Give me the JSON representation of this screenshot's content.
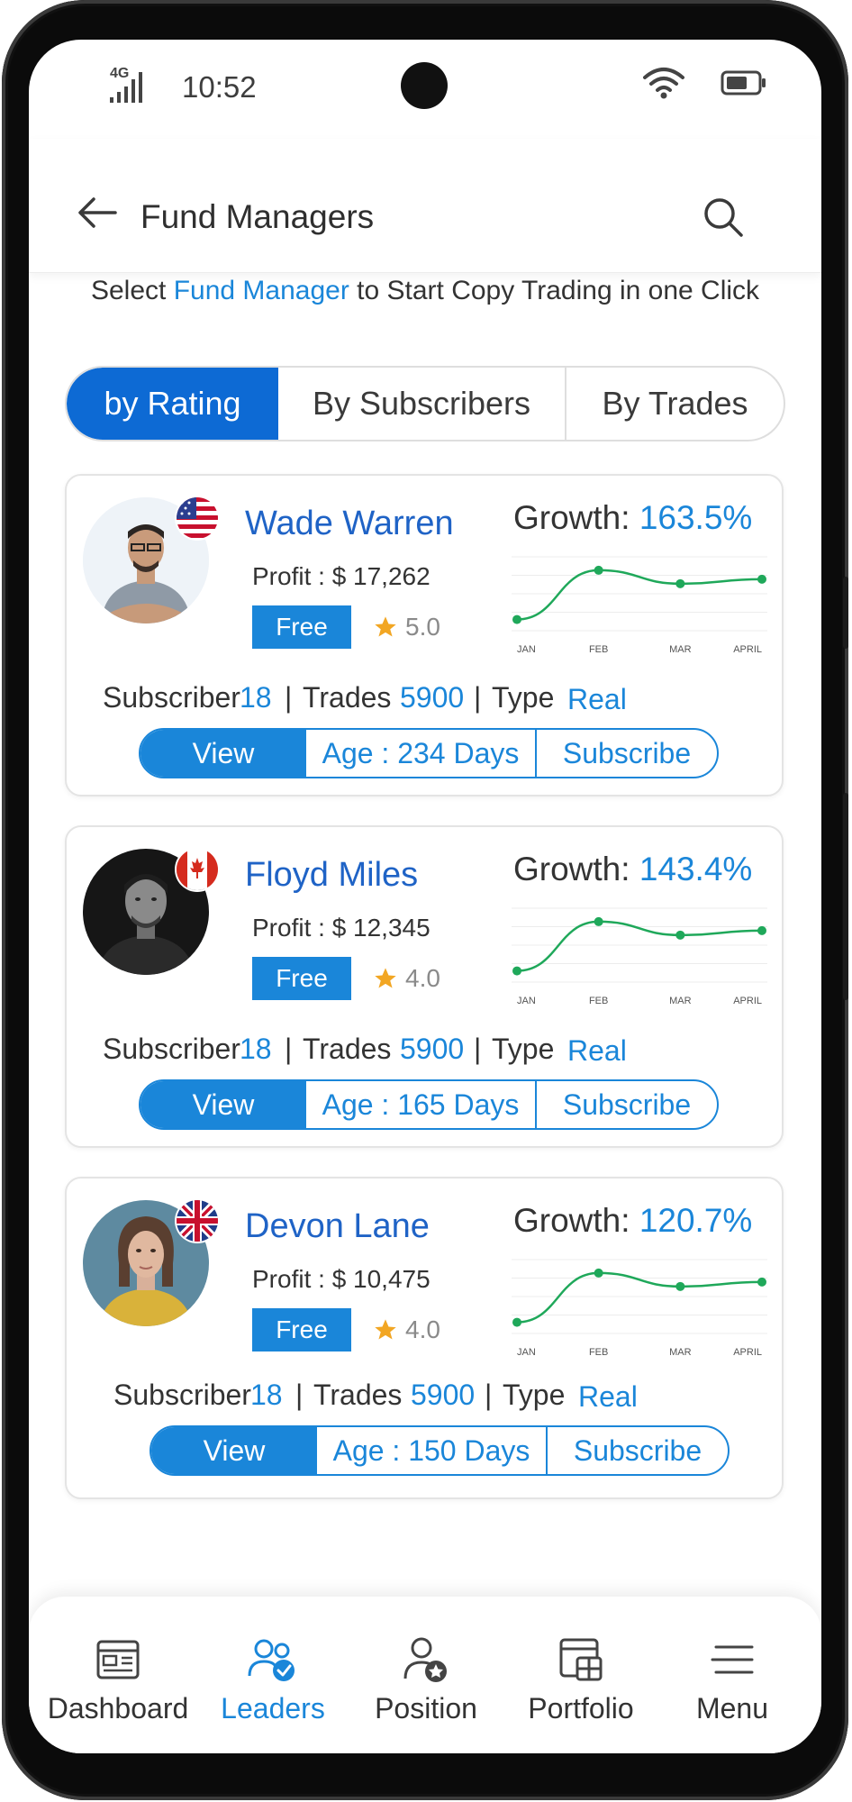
{
  "status_bar": {
    "network": "4G",
    "time": "10:52"
  },
  "header": {
    "title": "Fund Managers"
  },
  "intro": {
    "prefix": "Select",
    "highlight": "Fund Manager",
    "suffix": "to Start Copy Trading in one Click"
  },
  "sort_tabs": [
    {
      "label": "by Rating",
      "active": true
    },
    {
      "label": "By Subscribers",
      "active": false
    },
    {
      "label": "By Trades",
      "active": false
    }
  ],
  "chart_months": [
    "JAN",
    "FEB",
    "MAR",
    "APRIL"
  ],
  "managers": [
    {
      "name": "Wade Warren",
      "flag_country": "USA",
      "profit": "Profit : $ 17,262",
      "plan": "Free",
      "rating": "5.0",
      "growth_label": "Growth:",
      "growth": "163.5%",
      "subscriber_label": "Subscriber",
      "subscribers": "18",
      "trades_label": "Trades",
      "trades": "5900",
      "type_label": "Type",
      "type": "Real",
      "view_label": "View",
      "age": "Age : 234 Days",
      "subscribe_label": "Subscribe",
      "chart_data": {
        "type": "line",
        "x": [
          "JAN",
          "FEB",
          "MAR",
          "APRIL"
        ],
        "values": [
          1,
          3.2,
          2.6,
          2.8
        ]
      }
    },
    {
      "name": "Floyd Miles",
      "flag_country": "Canada",
      "profit": "Profit : $ 12,345",
      "plan": "Free",
      "rating": "4.0",
      "growth_label": "Growth:",
      "growth": "143.4%",
      "subscriber_label": "Subscriber",
      "subscribers": "18",
      "trades_label": "Trades",
      "trades": "5900",
      "type_label": "Type",
      "type": "Real",
      "view_label": "View",
      "age": "Age : 165 Days",
      "subscribe_label": "Subscribe",
      "chart_data": {
        "type": "line",
        "x": [
          "JAN",
          "FEB",
          "MAR",
          "APRIL"
        ],
        "values": [
          1,
          3.2,
          2.6,
          2.8
        ]
      }
    },
    {
      "name": "Devon Lane",
      "flag_country": "UK",
      "profit": "Profit : $ 10,475",
      "plan": "Free",
      "rating": "4.0",
      "growth_label": "Growth:",
      "growth": "120.7%",
      "subscriber_label": "Subscriber",
      "subscribers": "18",
      "trades_label": "Trades",
      "trades": "5900",
      "type_label": "Type",
      "type": "Real",
      "view_label": "View",
      "age": "Age : 150 Days",
      "subscribe_label": "Subscribe",
      "chart_data": {
        "type": "line",
        "x": [
          "JAN",
          "FEB",
          "MAR",
          "APRIL"
        ],
        "values": [
          1,
          3.2,
          2.6,
          2.8
        ]
      }
    }
  ],
  "bottom_nav": [
    {
      "label": "Dashboard",
      "icon": "dashboard-icon",
      "active": false
    },
    {
      "label": "Leaders",
      "icon": "leaders-icon",
      "active": true
    },
    {
      "label": "Position",
      "icon": "position-icon",
      "active": false
    },
    {
      "label": "Portfolio",
      "icon": "portfolio-icon",
      "active": false
    },
    {
      "label": "Menu",
      "icon": "menu-icon",
      "active": false
    }
  ],
  "colors": {
    "primary": "#1a86d9",
    "tab_active": "#0d6ad4",
    "chart_line": "#1fa85a",
    "star": "#f2a623"
  }
}
